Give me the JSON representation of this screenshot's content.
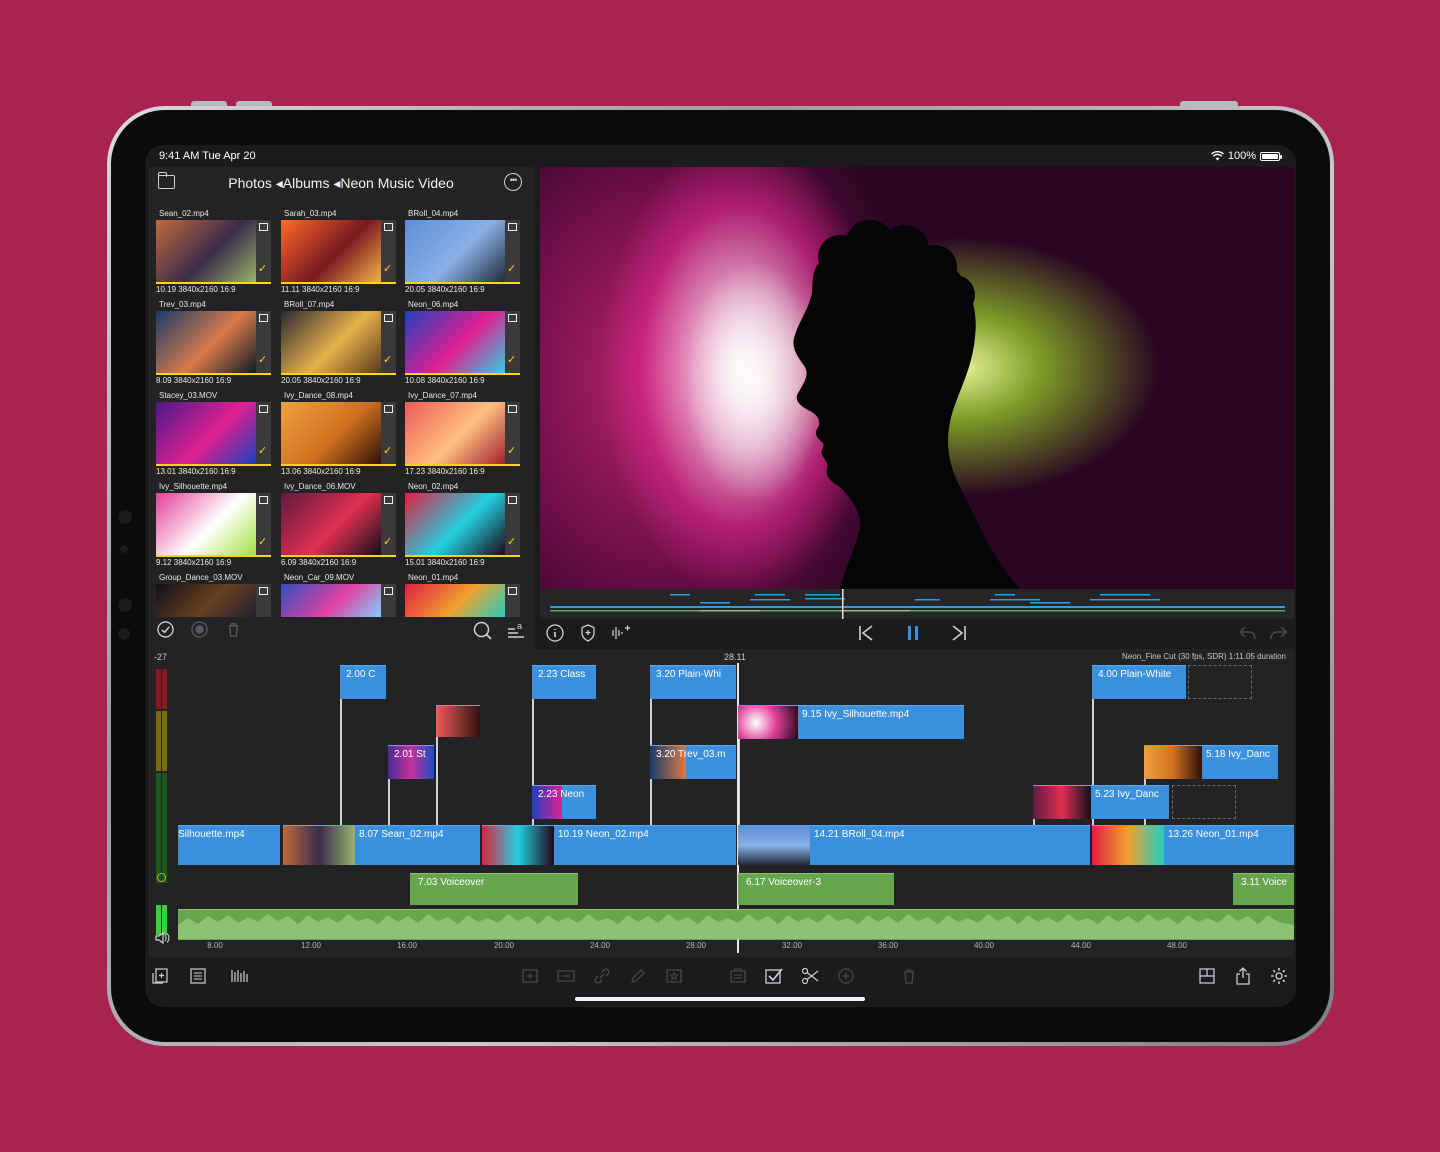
{
  "status": {
    "time": "9:41 AM  Tue Apr 20",
    "battery": "100%"
  },
  "browser": {
    "breadcrumb": "Photos ◂Albums ◂Neon Music Video",
    "more_icon": "ellipsis-circle-icon",
    "clips": [
      {
        "name": "Sean_02.mp4",
        "meta": "10.19  3840x2160  16:9",
        "colors": [
          "#c26a3a",
          "#3b2b4a",
          "#9ab36d"
        ]
      },
      {
        "name": "Sarah_03.mp4",
        "meta": "11.11  3840x2160  16:9",
        "colors": [
          "#ff6a2a",
          "#7a1820",
          "#f4b24a"
        ]
      },
      {
        "name": "BRoll_04.mp4",
        "meta": "20.05  3840x2160  16:9",
        "colors": [
          "#5c8fd8",
          "#8ab0e8",
          "#1f2a3a"
        ]
      },
      {
        "name": "Trev_03.mp4",
        "meta": "8.09  3840x2160  16:9",
        "colors": [
          "#1b3b6a",
          "#d87a4a",
          "#0e1a2a"
        ]
      },
      {
        "name": "BRoll_07.mp4",
        "meta": "20.05  3840x2160  16:9",
        "colors": [
          "#2a2a30",
          "#e8b04a",
          "#5a3a1a"
        ]
      },
      {
        "name": "Neon_06.mp4",
        "meta": "10.08  3840x2160  16:9",
        "colors": [
          "#2040c0",
          "#e02090",
          "#30d0e0"
        ]
      },
      {
        "name": "Stacey_03.MOV",
        "meta": "13.01  3840x2160  16:9",
        "colors": [
          "#4a1a8a",
          "#e02090",
          "#1a40c0"
        ]
      },
      {
        "name": "Ivy_Dance_08.mp4",
        "meta": "13.06  3840x2160  16:9",
        "colors": [
          "#f0a040",
          "#d07020",
          "#301008"
        ]
      },
      {
        "name": "Ivy_Dance_07.mp4",
        "meta": "17.23  3840x2160  16:9",
        "colors": [
          "#f05a5a",
          "#ffc080",
          "#a02030"
        ]
      },
      {
        "name": "Ivy_Silhouette.mp4",
        "meta": "9.12  3840x2160  16:9",
        "colors": [
          "#e0409a",
          "#ffffff",
          "#a0e040"
        ]
      },
      {
        "name": "Ivy_Dance_06.MOV",
        "meta": "6.09  3840x2160  16:9",
        "colors": [
          "#601a40",
          "#e03050",
          "#101018"
        ]
      },
      {
        "name": "Neon_02.mp4",
        "meta": "15.01  3840x2160  16:9",
        "colors": [
          "#e02040",
          "#20d0e0",
          "#200818"
        ]
      },
      {
        "name": "Group_Dance_03.MOV",
        "meta": "",
        "colors": [
          "#101018",
          "#6a4020",
          "#202030"
        ]
      },
      {
        "name": "Neon_Car_09.MOV",
        "meta": "",
        "colors": [
          "#3050c0",
          "#e040a0",
          "#80d0ff"
        ]
      },
      {
        "name": "Neon_01.mp4",
        "meta": "",
        "colors": [
          "#e02040",
          "#f0a030",
          "#20d0c0"
        ]
      }
    ]
  },
  "browser_toolbar": [
    "checkmark-circle-icon",
    "record-icon",
    "trash-icon",
    "search-icon",
    "sort-icon"
  ],
  "viewer_controls": [
    "info-icon",
    "shield-icon",
    "audio-icon",
    "skip-back-icon",
    "pause-icon",
    "skip-forward-icon",
    "undo-icon",
    "redo-icon"
  ],
  "timeline": {
    "level_top": "-27",
    "playhead": "28.11",
    "project_info": "Neon_Fine Cut (30 fps, SDR)  1:11.05 duration",
    "top_clips": [
      {
        "label": "2.00  C"
      },
      {
        "label": "2.23  Class"
      },
      {
        "label": "3.20  Plain-Whi"
      },
      {
        "label": "4.00  Plain-White"
      },
      {
        "label": "9.15  Ivy_Silhouette.mp4"
      },
      {
        "label": "2.01  St"
      },
      {
        "label": "3.20  Trev_03.m"
      },
      {
        "label": "5.18  Ivy_Danc"
      },
      {
        "label": "2.23  Neon"
      },
      {
        "label": "5.23  Ivy_Danc"
      }
    ],
    "main_clips": [
      {
        "label": "Silhouette.mp4"
      },
      {
        "label": "8.07  Sean_02.mp4"
      },
      {
        "label": "10.19  Neon_02.mp4"
      },
      {
        "label": "14.21  BRoll_04.mp4"
      },
      {
        "label": "13.26  Neon_01.mp4"
      }
    ],
    "voiceovers": [
      "7.03  Voiceover",
      "6.17  Voiceover-3",
      "3.11  Voice"
    ],
    "ruler": [
      "8.00",
      "12.00",
      "16.00",
      "20.00",
      "24.00",
      "28.00",
      "32.00",
      "36.00",
      "40.00",
      "44.00",
      "48.00"
    ]
  },
  "bottom_toolbar": {
    "left": [
      "add-media-icon",
      "list-icon",
      "waveform-icon"
    ],
    "center": [
      "insert-icon",
      "overwrite-icon",
      "link-icon",
      "pen-icon",
      "favorite-icon",
      "clipboard-icon",
      "checkbox-icon",
      "scissors-icon",
      "add-icon",
      "trash-icon"
    ],
    "right": [
      "layout-icon",
      "share-icon",
      "settings-icon"
    ]
  },
  "colors": {
    "clip_blue": "#3a90dd",
    "voiceover_green": "#67a64d",
    "background": "#a82252"
  }
}
